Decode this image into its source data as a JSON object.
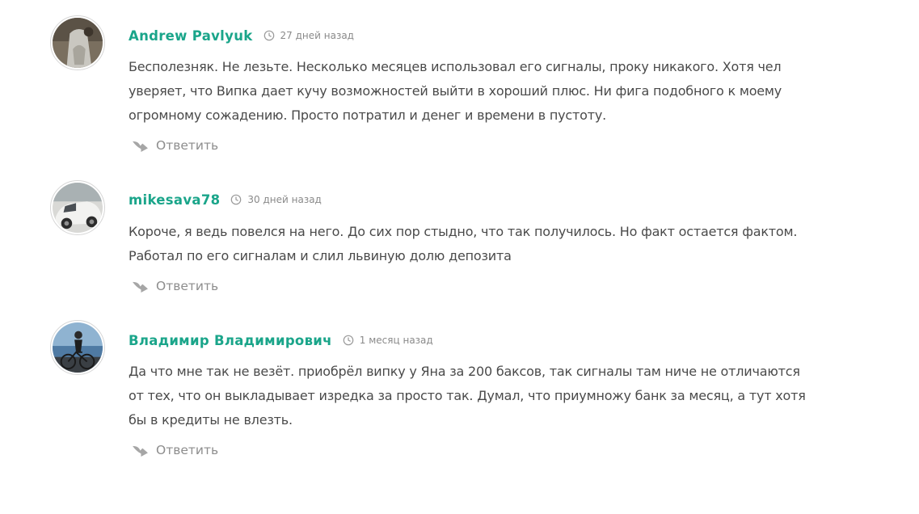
{
  "comments": [
    {
      "author": "Andrew Pavlyuk",
      "date": "27 дней назад",
      "text": "Бесполезняк. Не лезьте. Несколько месяцев использовал его сигналы, проку никакого. Хотя чел уверяет, что Випка дает кучу возможностей выйти в хороший плюс. Ни фига подобного к моему огромному сожадению. Просто потратил и денег и времени в пустоту.",
      "reply_label": "Ответить"
    },
    {
      "author": "mikesava78",
      "date": "30 дней назад",
      "text": "Короче, я ведь повелся на него. До сих пор стыдно, что так получилось. Но факт остается фактом. Работал по его сигналам и слил львиную долю депозита",
      "reply_label": "Ответить"
    },
    {
      "author": "Владимир Владимирович",
      "date": "1 месяц назад",
      "text": "Да что мне так не везёт. приобрёл випку у Яна за 200 баксов, так сигналы там ниче не отличаются от тех, что он выкладывает изредка за просто так. Думал, что приумножу банк за месяц, а тут хотя бы в кредиты не влезть.",
      "reply_label": "Ответить"
    }
  ],
  "icons": {
    "clock": "clock-icon",
    "reply": "reply-arrow-icon"
  },
  "colors": {
    "author": "#1aa58a",
    "meta": "#8a8a8a",
    "text": "#4a4a4a",
    "reply": "#8d8d8d"
  }
}
